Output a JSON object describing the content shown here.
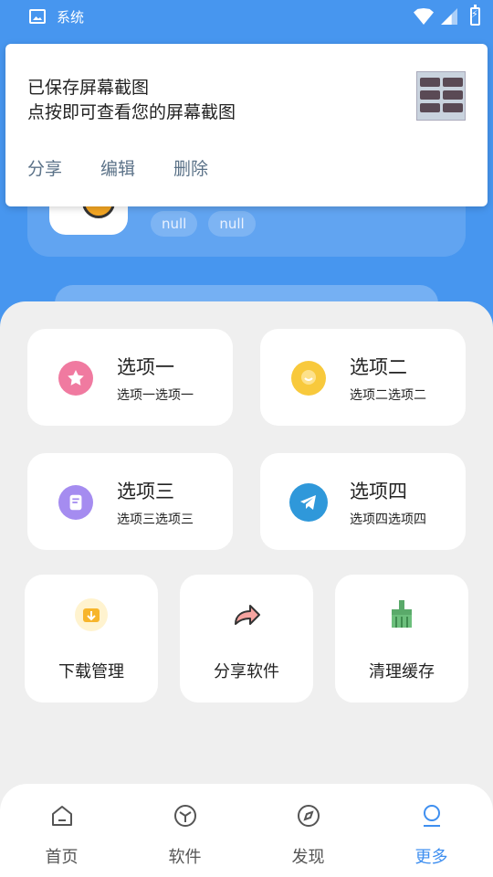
{
  "statusbar": {
    "app_label": "系统"
  },
  "profile": {
    "tags": [
      "null",
      "null"
    ]
  },
  "notification": {
    "title": "已保存屏幕截图",
    "subtitle": "点按即可查看您的屏幕截图",
    "actions": [
      "分享",
      "编辑",
      "删除"
    ]
  },
  "options": [
    {
      "title": "选项一",
      "subtitle": "选项一选项一",
      "icon": "star-icon",
      "color": "#f07aa0"
    },
    {
      "title": "选项二",
      "subtitle": "选项二选项二",
      "icon": "chat-bubble-icon",
      "color": "#f8c93c"
    },
    {
      "title": "选项三",
      "subtitle": "选项三选项三",
      "icon": "note-icon",
      "color": "#a58cf0"
    },
    {
      "title": "选项四",
      "subtitle": "选项四选项四",
      "icon": "telegram-icon",
      "color": "#2f98da"
    }
  ],
  "tools": [
    {
      "label": "下载管理",
      "icon": "download-folder-icon"
    },
    {
      "label": "分享软件",
      "icon": "share-arrow-icon"
    },
    {
      "label": "清理缓存",
      "icon": "broom-icon"
    }
  ],
  "nav": {
    "items": [
      {
        "label": "首页",
        "icon": "home-icon"
      },
      {
        "label": "软件",
        "icon": "box-icon"
      },
      {
        "label": "发现",
        "icon": "compass-icon"
      },
      {
        "label": "更多",
        "icon": "person-icon"
      }
    ],
    "active_index": 3,
    "active_color": "#3f8ff0"
  },
  "colors": {
    "brand_blue": "#4796ef",
    "panel_bg": "#efefef"
  }
}
